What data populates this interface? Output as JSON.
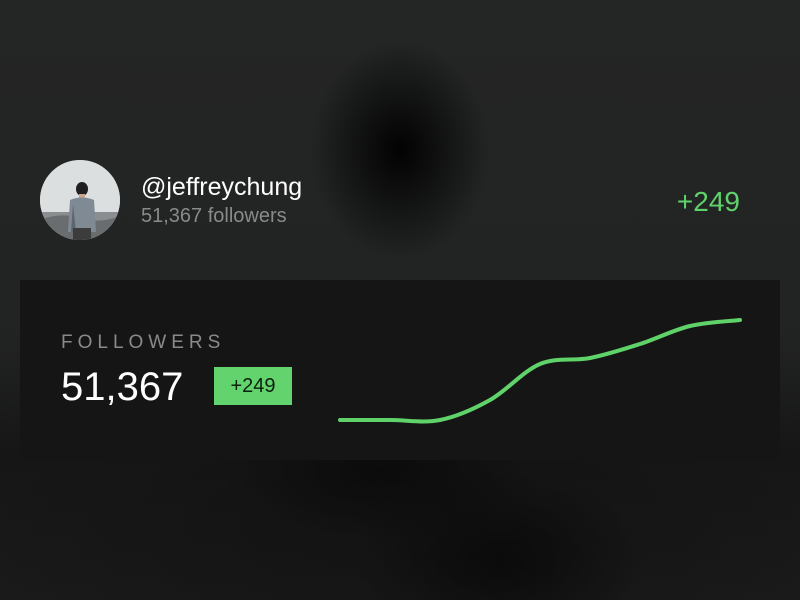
{
  "profile": {
    "username": "@jeffreychung",
    "followers_text": "51,367 followers",
    "delta": "+249"
  },
  "card": {
    "label": "FOLLOWERS",
    "count": "51,367",
    "badge": "+249"
  },
  "colors": {
    "accent": "#5fd36a",
    "badge_bg": "#63d46d",
    "card_bg": "#151515",
    "muted_text": "#8a8a8a"
  },
  "chart_data": {
    "type": "line",
    "x": [
      0,
      1,
      2,
      3,
      4,
      5,
      6,
      7,
      8
    ],
    "values": [
      0,
      0,
      0,
      10,
      28,
      31,
      38,
      47,
      50
    ],
    "title": "",
    "xlabel": "",
    "ylabel": "",
    "grid": false,
    "legend": "none"
  }
}
